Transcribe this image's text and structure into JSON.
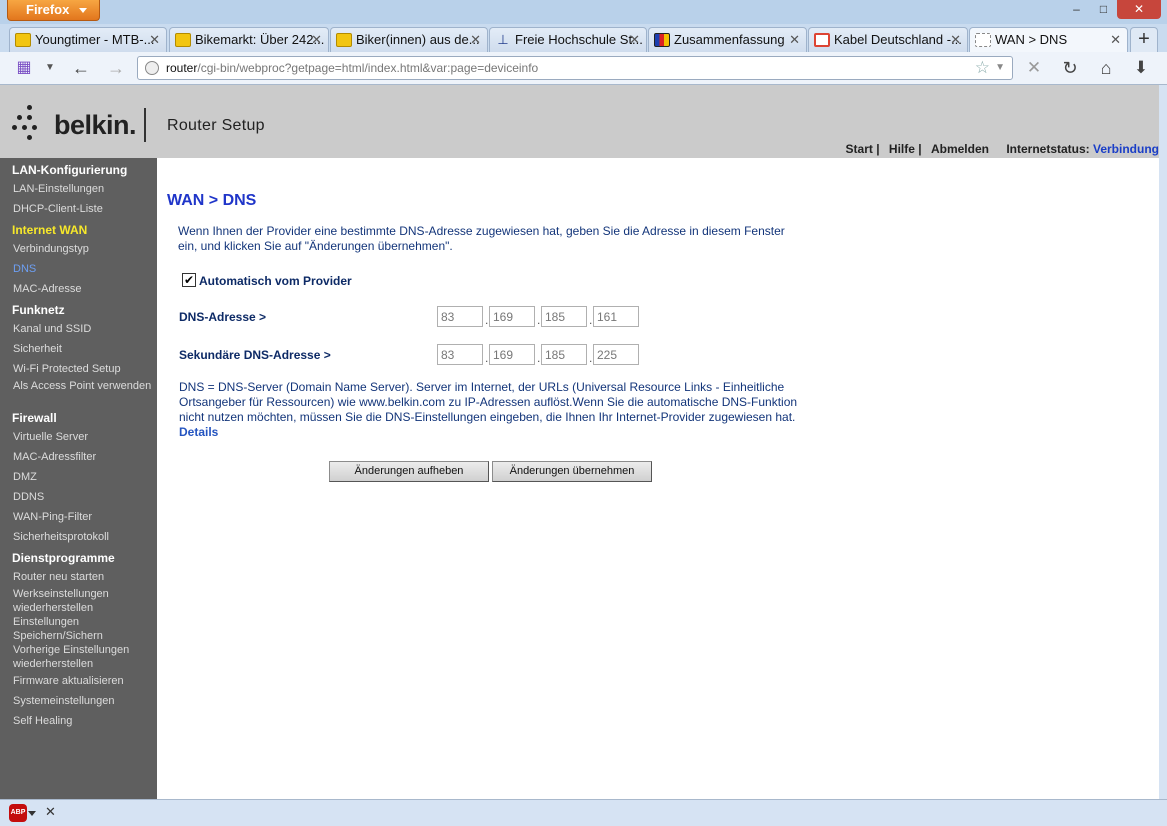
{
  "browser": {
    "menu_button": "Firefox",
    "window_controls": {
      "minimize": "–",
      "maximize": "□",
      "close": "✕"
    },
    "tabs": [
      {
        "label": "Youngtimer - MTB-...",
        "icon": "bike-icon"
      },
      {
        "label": "Bikemarkt: Über 242...",
        "icon": "bike-icon"
      },
      {
        "label": "Biker(innen) aus de...",
        "icon": "bike-icon"
      },
      {
        "label": "Freie Hochschule St...",
        "icon": "school-icon"
      },
      {
        "label": "Zusammenfassung",
        "icon": "flag-icon"
      },
      {
        "label": "Kabel Deutschland -...",
        "icon": "kabel-icon"
      },
      {
        "label": "WAN > DNS",
        "icon": "page-icon",
        "active": true
      }
    ],
    "new_tab": "+",
    "url_host": "router",
    "url_path": "/cgi-bin/webproc?getpage=html/index.html&var:page=deviceinfo"
  },
  "header": {
    "logo": "belkin.",
    "subtitle": "Router Setup",
    "nav": {
      "start": "Start |",
      "help": "Hilfe |",
      "logout": "Abmelden",
      "status_label": "Internetstatus:",
      "status_value": "Verbindung"
    }
  },
  "sidebar": {
    "sections": [
      {
        "title": "LAN-Konfigurierung",
        "items": [
          "LAN-Einstellungen",
          "DHCP-Client-Liste"
        ]
      },
      {
        "title": "Internet WAN",
        "items": [
          "Verbindungstyp",
          "DNS",
          "MAC-Adresse"
        ]
      },
      {
        "title": "Funknetz",
        "items": [
          "Kanal und SSID",
          "Sicherheit",
          "Wi-Fi Protected Setup",
          "Als Access Point verwenden"
        ]
      },
      {
        "title": "Firewall",
        "items": [
          "Virtuelle Server",
          "MAC-Adressfilter",
          "DMZ",
          "DDNS",
          "WAN-Ping-Filter",
          "Sicherheitsprotokoll"
        ]
      },
      {
        "title": "Dienstprogramme",
        "items": [
          "Router neu starten",
          "Werkseinstellungen wiederherstellen",
          "Einstellungen Speichern/Sichern",
          "Vorherige Einstellungen wiederherstellen",
          "Firmware aktualisieren",
          "Systemeinstellungen",
          "Self Healing"
        ]
      }
    ]
  },
  "main": {
    "title": "WAN > DNS",
    "intro": "Wenn Ihnen der Provider eine bestimmte DNS-Adresse zugewiesen hat, geben Sie die Adresse in diesem Fenster ein, und klicken Sie auf \"Änderungen übernehmen\".",
    "auto_checkbox": {
      "label": "Automatisch vom Provider",
      "checked": true,
      "mark": "✔"
    },
    "dns_label": "DNS-Adresse >",
    "dns": [
      "83",
      "169",
      "185",
      "161"
    ],
    "dns2_label": "Sekundäre DNS-Adresse >",
    "dns2": [
      "83",
      "169",
      "185",
      "225"
    ],
    "ip_separator": ".",
    "description": "DNS = DNS-Server (Domain Name Server). Server im Internet, der URLs (Universal Resource Links - Einheitliche Ortsangeber für Ressourcen) wie www.belkin.com zu IP-Adressen auflöst.Wenn Sie die automatische DNS-Funktion nicht nutzen möchten, müssen Sie die DNS-Einstellungen eingeben, die Ihnen Ihr Internet-Provider zugewiesen hat.",
    "details_link": "Details",
    "cancel_button": "Änderungen aufheben",
    "apply_button": "Änderungen übernehmen"
  },
  "addon_bar": {
    "abp_label": "ABP",
    "close": "✕"
  }
}
